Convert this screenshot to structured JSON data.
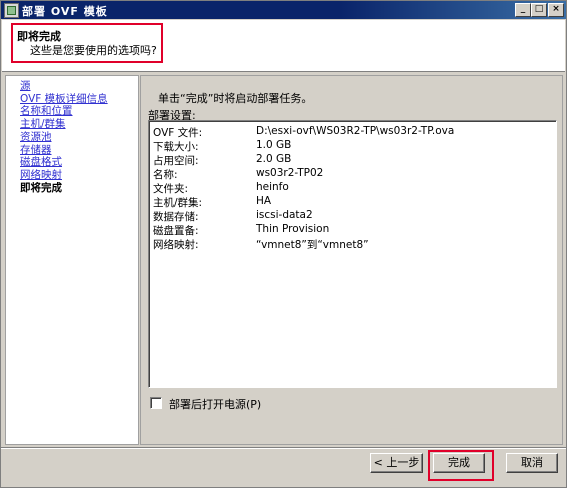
{
  "window": {
    "title": "部署 OVF 模板"
  },
  "titlebar_buttons": {
    "minimize": "_",
    "maximize": "□",
    "close": "×"
  },
  "header": {
    "title": "即将完成",
    "subtitle": "这些是您要使用的选项吗?"
  },
  "nav": {
    "items": [
      {
        "label": "源",
        "current": false
      },
      {
        "label": "OVF 模板详细信息",
        "current": false
      },
      {
        "label": "名称和位置",
        "current": false
      },
      {
        "label": "主机/群集",
        "current": false
      },
      {
        "label": "资源池",
        "current": false
      },
      {
        "label": "存储器",
        "current": false
      },
      {
        "label": "磁盘格式",
        "current": false
      },
      {
        "label": "网络映射",
        "current": false
      },
      {
        "label": "即将完成",
        "current": true
      }
    ]
  },
  "main": {
    "instruction": "单击“完成”时将启动部署任务。",
    "settings_label": "部署设置:",
    "settings": [
      {
        "key": "OVF 文件:",
        "value": "D:\\esxi-ovf\\WS03R2-TP\\ws03r2-TP.ova"
      },
      {
        "key": "下载大小:",
        "value": "1.0 GB"
      },
      {
        "key": "占用空间:",
        "value": "2.0 GB"
      },
      {
        "key": "名称:",
        "value": "ws03r2-TP02"
      },
      {
        "key": "文件夹:",
        "value": "heinfo"
      },
      {
        "key": "主机/群集:",
        "value": "HA"
      },
      {
        "key": "数据存储:",
        "value": "iscsi-data2"
      },
      {
        "key": "磁盘置备:",
        "value": "Thin Provision"
      },
      {
        "key": "网络映射:",
        "value": "“vmnet8”到“vmnet8”"
      }
    ],
    "power_on_label": "部署后打开电源(P)",
    "power_on_checked": false
  },
  "buttons": {
    "back": "< 上一步",
    "finish": "完成",
    "cancel": "取消"
  },
  "colors": {
    "highlight": "#e0002a",
    "link": "#3030d0",
    "titlebar": "#0a246a"
  }
}
